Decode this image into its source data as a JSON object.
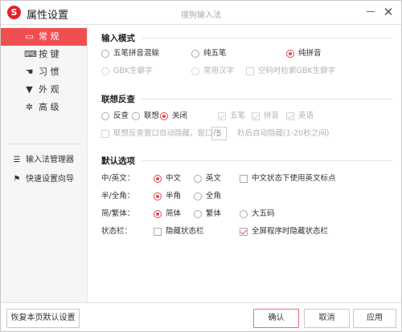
{
  "window": {
    "title": "属性设置",
    "center_title": "搜狗输入法",
    "logo_glyph": "S",
    "accent_color": "#f04f52"
  },
  "sidebar": {
    "items": [
      {
        "label": "常 规",
        "icon": "monitor-icon",
        "active": true
      },
      {
        "label": "按 键",
        "icon": "keyboard-icon",
        "active": false
      },
      {
        "label": "习 惯",
        "icon": "hand-icon",
        "active": false
      },
      {
        "label": "外 观",
        "icon": "shirt-icon",
        "active": false
      },
      {
        "label": "高 级",
        "icon": "gear-icon",
        "active": false
      }
    ],
    "tools": [
      {
        "label": "输入法管理器",
        "icon": "list-icon"
      },
      {
        "label": "快速设置向导",
        "icon": "flag-icon"
      }
    ]
  },
  "input_mode": {
    "title": "输入模式",
    "options": [
      "五笔拼音混输",
      "纯五笔",
      "纯拼音"
    ],
    "selected": "纯拼音",
    "sub_options": [
      "GBK生僻字",
      "常用汉字"
    ],
    "gbk_check": "空码时检索GBK生僻字"
  },
  "lookup": {
    "title": "联想反查",
    "options": [
      "反查",
      "联想",
      "关闭"
    ],
    "selected": "关闭",
    "checks": [
      "五笔",
      "拼音",
      "英语"
    ],
    "auto_hide_label": "联想反查窗口自动隐藏，窗口在",
    "auto_hide_seconds": "5",
    "auto_hide_suffix": "秒后自动隐藏(1-20秒之间)"
  },
  "defaults": {
    "title": "默认选项",
    "rows": [
      {
        "label": "中/英文：",
        "options": [
          "中文",
          "英文"
        ],
        "selected": "中文",
        "extra_check": "中文状态下使用英文标点",
        "extra_checked": false
      },
      {
        "label": "半/全角：",
        "options": [
          "半角",
          "全角"
        ],
        "selected": "半角"
      },
      {
        "label": "简/繁体：",
        "options": [
          "简体",
          "繁体",
          "大五码"
        ],
        "selected": "简体"
      },
      {
        "label": "状态栏：",
        "checks": [
          {
            "label": "隐藏状态栏",
            "checked": false
          },
          {
            "label": "全屏程序时隐藏状态栏",
            "checked": true
          }
        ]
      }
    ]
  },
  "footer": {
    "restore_label": "恢复本页默认设置",
    "ok_label": "确认",
    "cancel_label": "取消",
    "apply_label": "应用"
  }
}
